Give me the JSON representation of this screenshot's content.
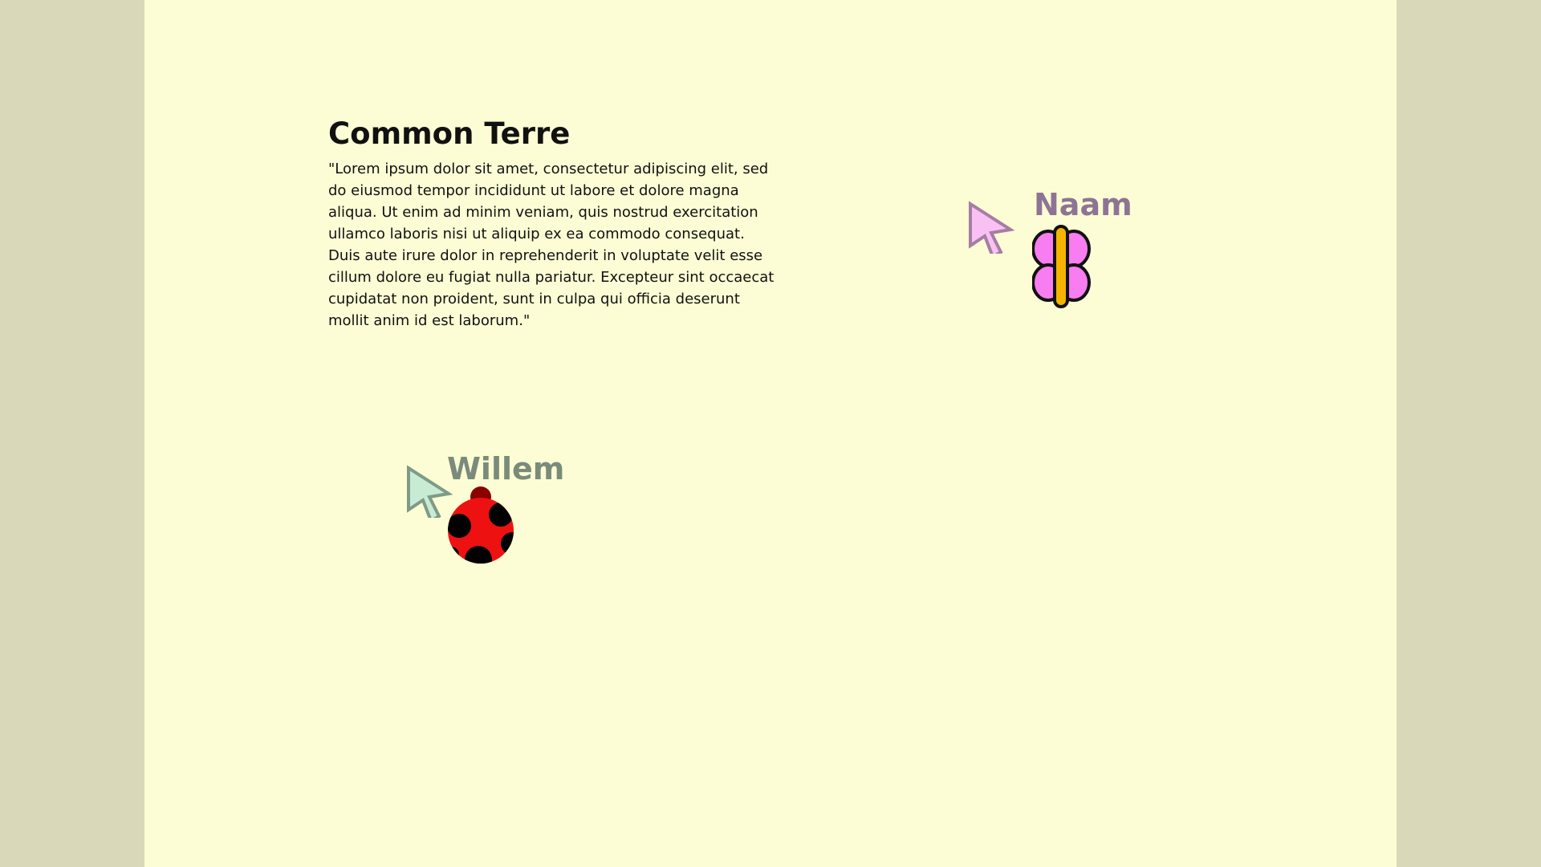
{
  "document": {
    "title": "Common Terre",
    "body": "\"Lorem ipsum dolor sit amet, consectetur adipiscing elit, sed do eiusmod tempor incididunt ut labore et dolore magna aliqua. Ut enim ad minim veniam, quis nostrud exercitation ullamco laboris nisi ut aliquip ex ea commodo consequat. Duis aute irure dolor in reprehenderit in voluptate velit esse cillum dolore eu fugiat nulla pariatur. Excepteur sint occaecat cupidatat non proident, sunt in culpa qui officia deserunt mollit anim id est laborum.\""
  },
  "collaborators": [
    {
      "name": "Naam",
      "color": "#8e7494",
      "cursor_fill": "#f9c1f3",
      "cursor_stroke": "#a57ea1",
      "avatar": "butterfly-icon"
    },
    {
      "name": "Willem",
      "color": "#7a8b7a",
      "cursor_fill": "#c7ecd3",
      "cursor_stroke": "#7f9a88",
      "avatar": "ladybug-icon"
    }
  ],
  "colors": {
    "page_background": "#fcfdd5",
    "outer_background": "#d9d9b9"
  }
}
